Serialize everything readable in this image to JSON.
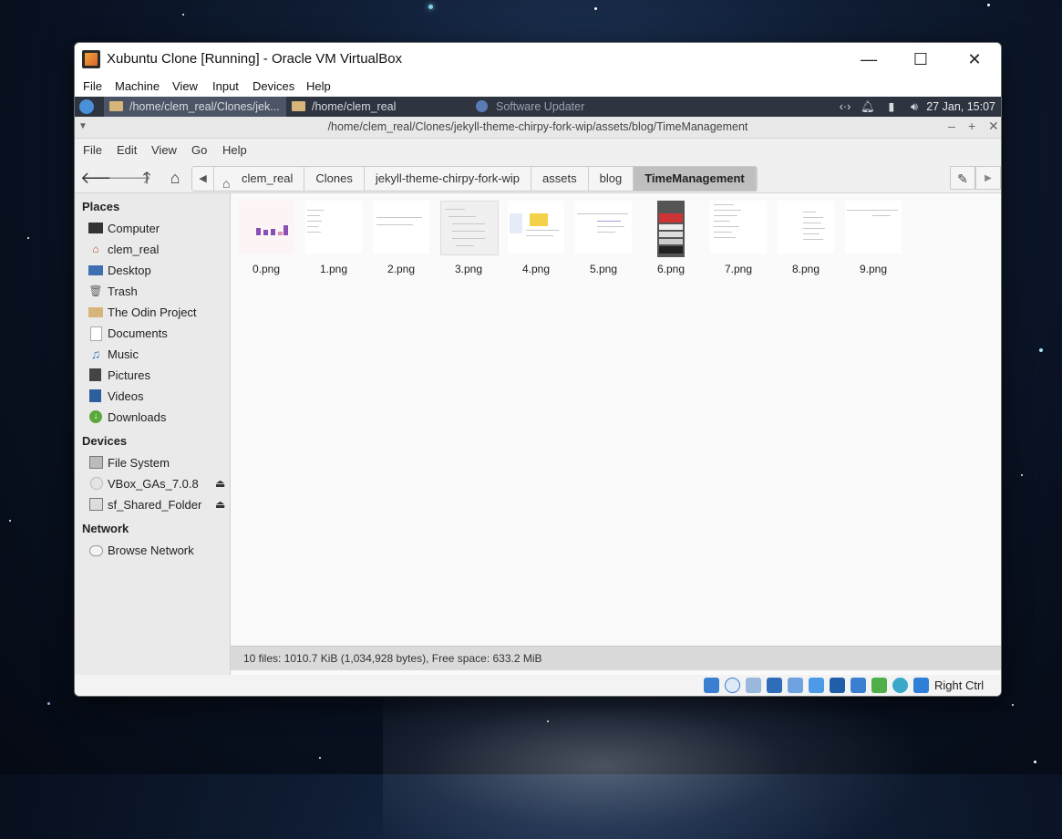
{
  "vbox": {
    "title": "Xubuntu Clone [Running] - Oracle VM VirtualBox",
    "menu": [
      "File",
      "Machine",
      "View",
      "Input",
      "Devices",
      "Help"
    ],
    "host_key": "Right Ctrl",
    "status_icons": [
      "hard-disk-icon",
      "optical-drive-icon",
      "audio-icon",
      "network-icon",
      "usb-icon",
      "shared-folders-icon",
      "display-icon",
      "recording-icon",
      "cpu-icon",
      "mouse-integration-icon",
      "keyboard-icon"
    ]
  },
  "xpanel": {
    "tasks": [
      "/home/clem_real/Clones/jek...",
      "/home/clem_real",
      "Software Updater"
    ],
    "clock": "27 Jan, 15:07"
  },
  "thunar": {
    "title": "/home/clem_real/Clones/jekyll-theme-chirpy-fork-wip/assets/blog/TimeManagement",
    "menu": [
      "File",
      "Edit",
      "View",
      "Go",
      "Help"
    ],
    "breadcrumbs": [
      "clem_real",
      "Clones",
      "jekyll-theme-chirpy-fork-wip",
      "assets",
      "blog",
      "TimeManagement"
    ],
    "sidebar": {
      "places_label": "Places",
      "places": [
        "Computer",
        "clem_real",
        "Desktop",
        "Trash",
        "The Odin Project",
        "Documents",
        "Music",
        "Pictures",
        "Videos",
        "Downloads"
      ],
      "devices_label": "Devices",
      "devices": [
        "File System",
        "VBox_GAs_7.0.8",
        "sf_Shared_Folder"
      ],
      "network_label": "Network",
      "network": [
        "Browse Network"
      ]
    },
    "files": [
      "0.png",
      "1.png",
      "2.png",
      "3.png",
      "4.png",
      "5.png",
      "6.png",
      "7.png",
      "8.png",
      "9.png"
    ],
    "status": "10 files: 1010.7 KiB (1,034,928 bytes), Free space: 633.2 MiB"
  }
}
